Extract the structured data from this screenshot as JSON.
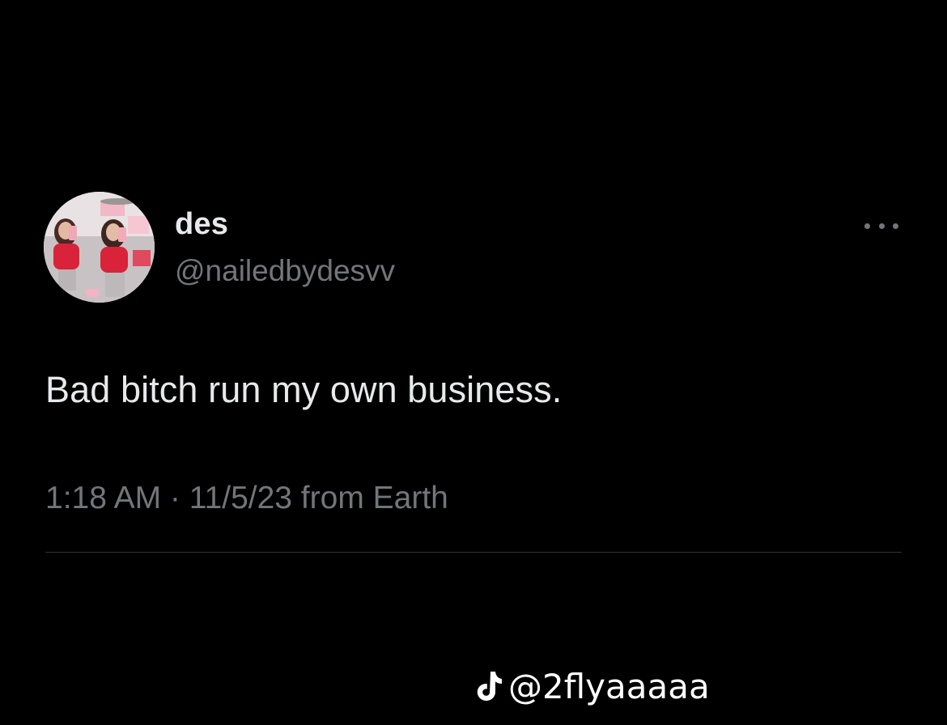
{
  "tweet": {
    "author": {
      "display_name": "des",
      "handle": "@nailedbydesvv"
    },
    "text": "Bad bitch run my own business.",
    "meta": "1:18 AM · 11/5/23 from Earth",
    "more_icon": "more-horizontal-icon"
  },
  "watermark": {
    "icon": "tiktok-icon",
    "text": "@2flyaaaaa"
  },
  "colors": {
    "background": "#000000",
    "primary_text": "#e7e9ea",
    "secondary_text": "#71767b",
    "divider": "#2f3336",
    "avatar_accent": "#d8233a"
  }
}
